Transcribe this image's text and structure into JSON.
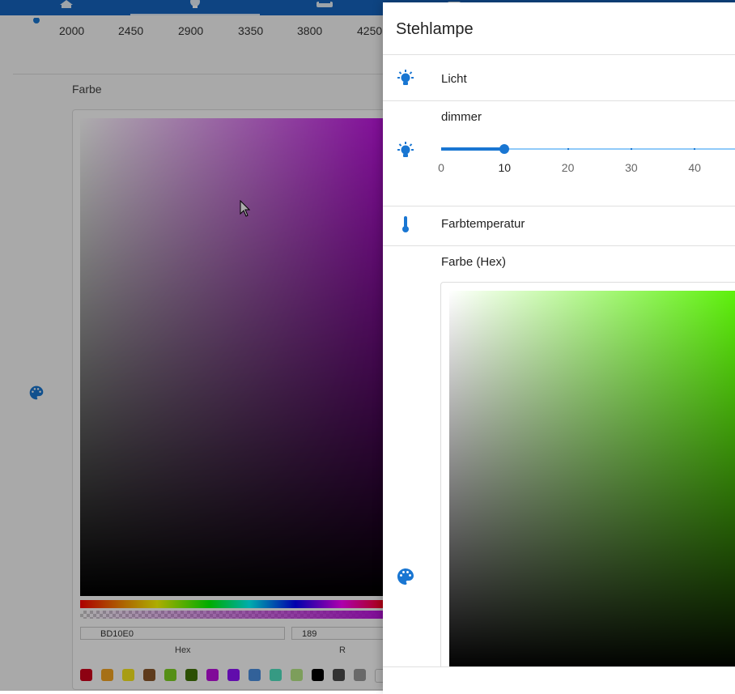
{
  "background": {
    "color_temp_ticks": [
      "2000",
      "2450",
      "2900",
      "3350",
      "3800",
      "4250"
    ],
    "color_label": "Farbe",
    "hex_value": "BD10E0",
    "r_value": "189",
    "hex_label": "Hex",
    "r_label": "R",
    "swatches": [
      "#d0021b",
      "#f5a623",
      "#f8e71c",
      "#8b572a",
      "#7ed321",
      "#417505",
      "#bd10e0",
      "#9013fe",
      "#4a90e2",
      "#50e3c2",
      "#b8e986",
      "#000000",
      "#4a4a4a",
      "#9b9b9b",
      "#ffffff"
    ],
    "top_icons": [
      "home-icon",
      "lightbulb-icon",
      "sofa-icon",
      "bed-icon"
    ],
    "accent": "#1565c0"
  },
  "dialog": {
    "title": "Stehlampe",
    "rows": {
      "light_label": "Licht",
      "dimmer_label": "dimmer",
      "color_temp_label": "Farbtemperatur",
      "color_hex_label": "Farbe (Hex)"
    },
    "slider": {
      "value": 10,
      "min": 0,
      "max": 47,
      "ticks": [
        "0",
        "10",
        "20",
        "30",
        "40"
      ]
    },
    "accent": "#1976d2"
  }
}
